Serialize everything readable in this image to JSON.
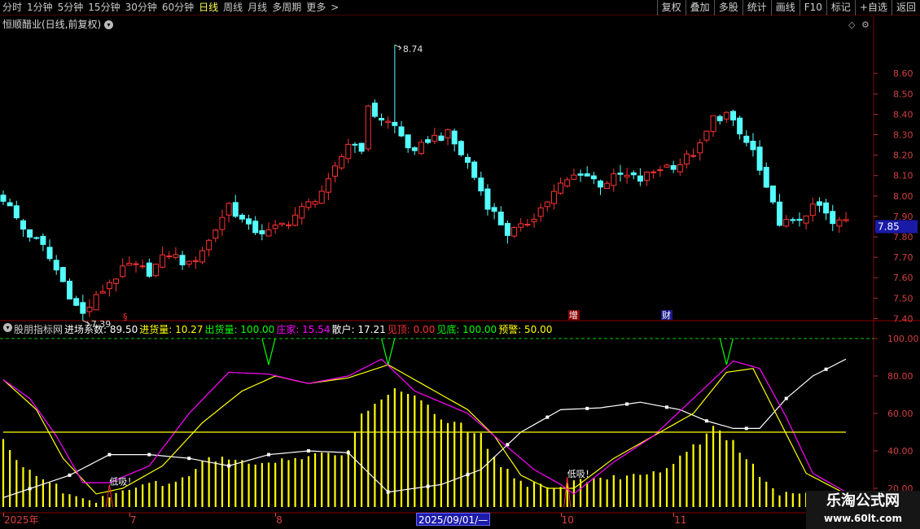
{
  "toolbar": {
    "periods": [
      {
        "label": "分时",
        "active": false
      },
      {
        "label": "1分钟",
        "active": false
      },
      {
        "label": "5分钟",
        "active": false
      },
      {
        "label": "15分钟",
        "active": false
      },
      {
        "label": "30分钟",
        "active": false
      },
      {
        "label": "60分钟",
        "active": false
      },
      {
        "label": "日线",
        "active": true
      },
      {
        "label": "周线",
        "active": false
      },
      {
        "label": "月线",
        "active": false
      },
      {
        "label": "多周期",
        "active": false
      },
      {
        "label": "更多",
        "active": false
      }
    ],
    "more_chevron": ">",
    "tools": [
      "复权",
      "叠加",
      "多股",
      "统计",
      "画线",
      "F10",
      "标记",
      "+自选",
      "返回"
    ]
  },
  "stock": {
    "title": "恒顺醋业(日线,前复权)",
    "current_price": "7.85",
    "high_label": "8.74",
    "low_label": "7.39"
  },
  "chart_data": [
    {
      "type": "candlestick",
      "ylim": [
        7.35,
        8.8
      ],
      "yticks": [
        7.4,
        7.5,
        7.6,
        7.7,
        7.8,
        7.9,
        8.0,
        8.1,
        8.2,
        8.3,
        8.4,
        8.5,
        8.6
      ],
      "ytick_labels": [
        "7.40",
        "7.50",
        "7.60",
        "7.70",
        "7.80",
        "7.90",
        "8.00",
        "8.10",
        "8.20",
        "8.30",
        "8.40",
        "8.50",
        "8.60"
      ],
      "anchors": [
        [
          0,
          7.99
        ],
        [
          3,
          7.84
        ],
        [
          6,
          7.75
        ],
        [
          9,
          7.58
        ],
        [
          11,
          7.46
        ],
        [
          12,
          7.42
        ],
        [
          14,
          7.5
        ],
        [
          16,
          7.58
        ],
        [
          19,
          7.66
        ],
        [
          22,
          7.63
        ],
        [
          25,
          7.72
        ],
        [
          28,
          7.66
        ],
        [
          31,
          7.78
        ],
        [
          34,
          7.96
        ],
        [
          37,
          7.84
        ],
        [
          40,
          7.82
        ],
        [
          43,
          7.88
        ],
        [
          46,
          7.96
        ],
        [
          49,
          8.06
        ],
        [
          52,
          8.26
        ],
        [
          54,
          8.24
        ],
        [
          55,
          8.42
        ],
        [
          57,
          8.38
        ],
        [
          59,
          8.34
        ],
        [
          62,
          8.2
        ],
        [
          64,
          8.28
        ],
        [
          67,
          8.3
        ],
        [
          70,
          8.16
        ],
        [
          73,
          7.96
        ],
        [
          76,
          7.82
        ],
        [
          78,
          7.84
        ],
        [
          81,
          7.94
        ],
        [
          84,
          8.05
        ],
        [
          87,
          8.12
        ],
        [
          90,
          8.06
        ],
        [
          93,
          8.1
        ],
        [
          96,
          8.08
        ],
        [
          99,
          8.14
        ],
        [
          102,
          8.16
        ],
        [
          105,
          8.24
        ],
        [
          107,
          8.38
        ],
        [
          109,
          8.4
        ],
        [
          111,
          8.3
        ],
        [
          113,
          8.22
        ],
        [
          115,
          8.02
        ],
        [
          117,
          7.88
        ],
        [
          119,
          7.86
        ],
        [
          121,
          7.92
        ],
        [
          123,
          7.95
        ],
        [
          125,
          7.86
        ],
        [
          127,
          7.88
        ]
      ],
      "markers": [
        {
          "text": "增",
          "index": 86
        },
        {
          "text": "财",
          "index": 100
        }
      ]
    },
    {
      "type": "line",
      "title": "股朋指标网",
      "ylim": [
        10,
        100
      ],
      "yticks": [
        20,
        40,
        60,
        80,
        100
      ],
      "ytick_labels": [
        "20.00",
        "40.00",
        "60.00",
        "80.00",
        "100.00"
      ],
      "series": [
        {
          "name": "进场系数",
          "value": "89.50",
          "color": "#ffffff",
          "anchors": [
            [
              0,
              15
            ],
            [
              10,
              27
            ],
            [
              16,
              38
            ],
            [
              22,
              38
            ],
            [
              28,
              36
            ],
            [
              34,
              32
            ],
            [
              40,
              38
            ],
            [
              46,
              40
            ],
            [
              52,
              39
            ],
            [
              58,
              18
            ],
            [
              66,
              22
            ],
            [
              72,
              30
            ],
            [
              78,
              50
            ],
            [
              84,
              62
            ],
            [
              90,
              63
            ],
            [
              96,
              66
            ],
            [
              102,
              62
            ],
            [
              106,
              56
            ],
            [
              110,
              52
            ],
            [
              114,
              52
            ],
            [
              118,
              68
            ],
            [
              122,
              80
            ],
            [
              127,
              89
            ]
          ]
        },
        {
          "name": "进货量",
          "value": "10.27",
          "color": "#ffff00",
          "anchors": [
            [
              0,
              78
            ],
            [
              5,
              62
            ],
            [
              9,
              36
            ],
            [
              14,
              17
            ],
            [
              18,
              20
            ],
            [
              24,
              32
            ],
            [
              30,
              55
            ],
            [
              36,
              72
            ],
            [
              41,
              80
            ],
            [
              46,
              76
            ],
            [
              52,
              79
            ],
            [
              58,
              86
            ],
            [
              64,
              74
            ],
            [
              70,
              62
            ],
            [
              74,
              48
            ],
            [
              78,
              27
            ],
            [
              82,
              20
            ],
            [
              86,
              20
            ],
            [
              92,
              36
            ],
            [
              98,
              48
            ],
            [
              104,
              60
            ],
            [
              109,
              82
            ],
            [
              113,
              84
            ],
            [
              117,
              56
            ],
            [
              121,
              28
            ],
            [
              127,
              17
            ]
          ]
        },
        {
          "name": "出货量",
          "value": "100.00",
          "color": "#00ff00",
          "anchors": []
        },
        {
          "name": "庄家",
          "value": "15.54",
          "color": "#ff00ff",
          "anchors": [
            [
              0,
              78
            ],
            [
              4,
              68
            ],
            [
              8,
              48
            ],
            [
              12,
              23
            ],
            [
              16,
              23
            ],
            [
              22,
              32
            ],
            [
              28,
              60
            ],
            [
              34,
              82
            ],
            [
              40,
              81
            ],
            [
              46,
              76
            ],
            [
              52,
              80
            ],
            [
              57,
              89
            ],
            [
              62,
              72
            ],
            [
              70,
              60
            ],
            [
              76,
              42
            ],
            [
              80,
              30
            ],
            [
              84,
              22
            ],
            [
              86,
              17
            ],
            [
              92,
              34
            ],
            [
              98,
              48
            ],
            [
              104,
              68
            ],
            [
              110,
              88
            ],
            [
              114,
              84
            ],
            [
              118,
              58
            ],
            [
              122,
              28
            ],
            [
              127,
              18
            ]
          ]
        },
        {
          "name": "散户",
          "value": "17.21",
          "color": "#ffffff",
          "anchors": []
        },
        {
          "name": "见顶",
          "value": "0.00",
          "color": "#ff3030",
          "anchors": []
        },
        {
          "name": "见底",
          "value": "100.00",
          "color": "#00ff00",
          "anchors": []
        },
        {
          "name": "预警",
          "value": "50.00",
          "color": "#ffff00",
          "anchors": [
            [
              0,
              50
            ],
            [
              127,
              50
            ]
          ]
        }
      ],
      "bars": {
        "color": "#ffff00",
        "anchors": [
          [
            0,
            45
          ],
          [
            4,
            28
          ],
          [
            8,
            22
          ],
          [
            10,
            15
          ],
          [
            14,
            14
          ],
          [
            18,
            18
          ],
          [
            22,
            22
          ],
          [
            26,
            22
          ],
          [
            30,
            34
          ],
          [
            34,
            37
          ],
          [
            38,
            34
          ],
          [
            42,
            34
          ],
          [
            46,
            37
          ],
          [
            50,
            38
          ],
          [
            52,
            40
          ],
          [
            54,
            58
          ],
          [
            56,
            66
          ],
          [
            59,
            72
          ],
          [
            62,
            68
          ],
          [
            66,
            58
          ],
          [
            69,
            54
          ],
          [
            72,
            48
          ],
          [
            75,
            32
          ],
          [
            78,
            23
          ],
          [
            82,
            21
          ],
          [
            86,
            24
          ],
          [
            90,
            25
          ],
          [
            96,
            28
          ],
          [
            100,
            30
          ],
          [
            104,
            42
          ],
          [
            107,
            52
          ],
          [
            110,
            44
          ],
          [
            114,
            28
          ],
          [
            117,
            18
          ],
          [
            121,
            16
          ],
          [
            124,
            18
          ],
          [
            127,
            12
          ]
        ]
      },
      "annotations": [
        {
          "text": "低吸！",
          "index": 16,
          "value": 22
        },
        {
          "text": "低吸！",
          "index": 85,
          "value": 26
        }
      ],
      "top_signals": [
        40,
        58,
        109
      ]
    }
  ],
  "dates": {
    "labels": [
      {
        "text": "2025年",
        "index": 0
      },
      {
        "text": "7",
        "index": 19
      },
      {
        "text": "8",
        "index": 41
      },
      {
        "text": "10",
        "index": 84
      },
      {
        "text": "11",
        "index": 101
      }
    ],
    "cursor": "2025/09/01/—"
  },
  "watermark": {
    "line1": "乐淘公式网",
    "line2": "www.60lt.com"
  }
}
